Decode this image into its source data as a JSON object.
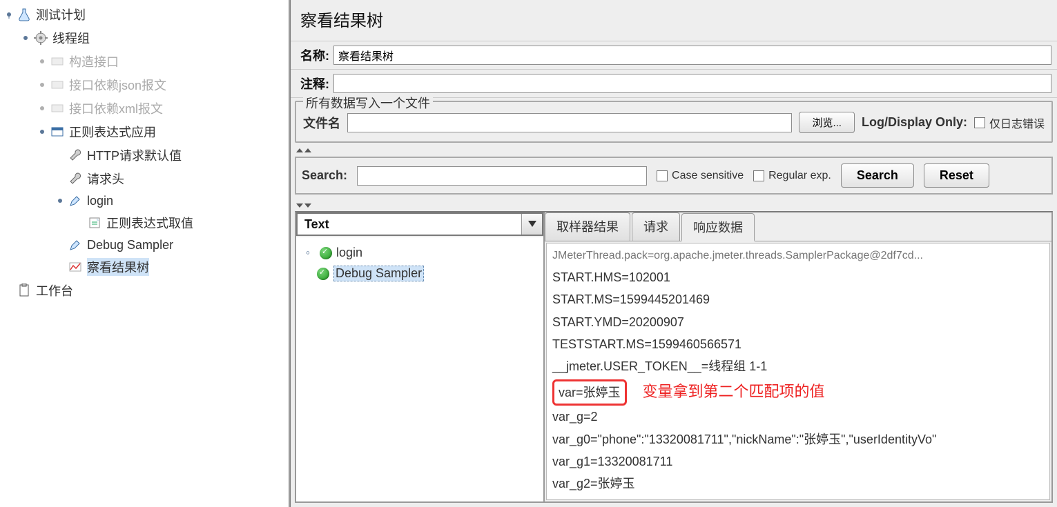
{
  "tree": {
    "testplan": "测试计划",
    "threadgroup": "线程组",
    "construct": "构造接口",
    "dep_json": "接口依赖json报文",
    "dep_xml": "接口依赖xml报文",
    "regex_app": "正则表达式应用",
    "http_defaults": "HTTP请求默认值",
    "headers": "请求头",
    "login": "login",
    "regex_extract": "正则表达式取值",
    "debug_sampler": "Debug Sampler",
    "view_tree": "察看结果树",
    "workbench": "工作台"
  },
  "panel": {
    "title": "察看结果树",
    "name_label": "名称:",
    "name_value": "察看结果树",
    "comment_label": "注释:",
    "comment_value": "",
    "filegroup_legend": "所有数据写入一个文件",
    "file_label": "文件名",
    "file_value": "",
    "browse_btn": "浏览...",
    "logdisplay": "Log/Display Only:",
    "log_only_errors": "仅日志错误"
  },
  "search": {
    "label": "Search:",
    "value": "",
    "case_sensitive": "Case sensitive",
    "regular_exp": "Regular exp.",
    "search_btn": "Search",
    "reset_btn": "Reset"
  },
  "results": {
    "combo": "Text",
    "items": [
      "login",
      "Debug Sampler"
    ],
    "tabs": {
      "sampler": "取样器结果",
      "request": "请求",
      "response": "响应数据"
    },
    "lines": [
      "JMeterThread.pack=org.apache.jmeter.threads.SamplerPackage@2df7cd...",
      "START.HMS=102001",
      "START.MS=1599445201469",
      "START.YMD=20200907",
      "TESTSTART.MS=1599460566571",
      "__jmeter.USER_TOKEN__=线程组 1-1",
      "var=张婷玉",
      "var_g=2",
      "var_g0=\"phone\":\"13320081711\",\"nickName\":\"张婷玉\",\"userIdentityVo\"",
      "var_g1=13320081711",
      "var_g2=张婷玉"
    ],
    "annotation": "变量拿到第二个匹配项的值"
  }
}
